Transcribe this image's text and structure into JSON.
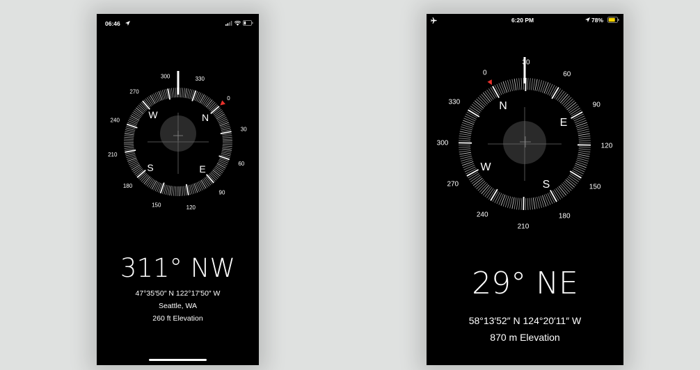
{
  "colors": {
    "accent_red": "#e8312b",
    "battery_yellow": "#f5d300",
    "background": "#dfe1e0"
  },
  "phone1": {
    "status_time": "06:46",
    "location_icon": "location-arrow-icon",
    "heading": "311° NW",
    "heading_deg": 311,
    "coordinates": "47°35′50″ N  122°17′50″ W",
    "place": "Seattle, WA",
    "elevation": "260 ft Elevation",
    "cardinals": {
      "N": "N",
      "E": "E",
      "S": "S",
      "W": "W"
    },
    "degree_labels": [
      "0",
      "30",
      "60",
      "90",
      "120",
      "150",
      "180",
      "210",
      "240",
      "270",
      "300",
      "330"
    ]
  },
  "phone2": {
    "status_time": "6:20 PM",
    "battery_percent": "78%",
    "battery_level": 0.78,
    "airplane_icon": "airplane-icon",
    "heading": "29° NE",
    "heading_deg": 29,
    "coordinates": "58°13′52″ N  124°20′11″ W",
    "elevation": "870 m Elevation",
    "cardinals": {
      "N": "N",
      "E": "E",
      "S": "S",
      "W": "W"
    },
    "degree_labels": [
      "0",
      "30",
      "60",
      "90",
      "120",
      "150",
      "180",
      "210",
      "240",
      "270",
      "300",
      "330"
    ]
  }
}
